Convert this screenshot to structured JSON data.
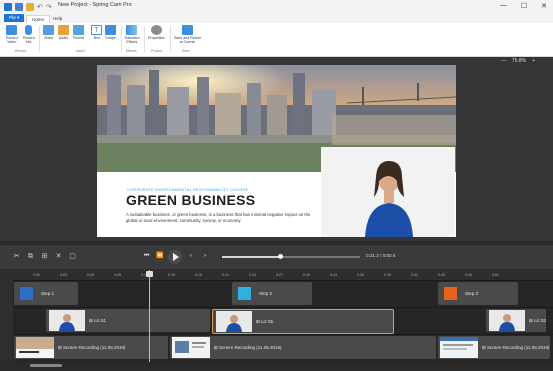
{
  "app": {
    "title": "New Project - Spring Cam Pro",
    "window_controls": [
      "—",
      "☐",
      "✕"
    ]
  },
  "ribbon": {
    "file_label": "File",
    "tabs": [
      {
        "label": "Home",
        "active": true
      },
      {
        "label": "Help",
        "active": false
      }
    ],
    "buttons": [
      {
        "label": "Record\nVideo",
        "icon": "record-video-icon"
      },
      {
        "label": "Record\nMic",
        "icon": "record-mic-icon"
      },
      {
        "label": "Video",
        "icon": "video-icon"
      },
      {
        "label": "Audio",
        "icon": "audio-icon"
      },
      {
        "label": "Picture",
        "icon": "picture-icon"
      },
      {
        "label": "Text",
        "icon": "text-icon"
      },
      {
        "label": "Shape",
        "icon": "shape-icon"
      },
      {
        "label": "Transition\nEffects",
        "icon": "transition-effects-icon"
      },
      {
        "label": "Properties",
        "icon": "properties-icon"
      },
      {
        "label": "Save and Return\nto Course",
        "icon": "save-return-icon"
      }
    ],
    "groups": [
      "Record",
      "Insert",
      "Effects",
      "Project",
      "Save"
    ]
  },
  "canvas": {
    "zoom_minus": "—",
    "zoom_value": "75.8%",
    "zoom_plus": "+",
    "slide": {
      "subtitle": "CORPORATE ENVIRONMENTAL RESPONSIBILITY COURSE",
      "headline": "GREEN BUSINESS",
      "body": "A sustainable business, or green business, is a business that has minimal negative impact on the global or local environment, community, society, or economy."
    }
  },
  "playback": {
    "tools": [
      "✂",
      "⧉",
      "⊞",
      "✕",
      "▢"
    ],
    "time": "0:21.2 / 0:50.6"
  },
  "timeline": {
    "ticks": [
      "0:00",
      "0:03",
      "0:06",
      "0:09",
      "0:12",
      "0:15",
      "0:18",
      "0:21",
      "0:24",
      "0:27",
      "0:30",
      "0:33",
      "0:36",
      "0:39",
      "0:42",
      "0:45",
      "0:48",
      "0:51"
    ],
    "steps": [
      {
        "label": "Step 1",
        "color": "#2f6fc9"
      },
      {
        "label": "Step 2",
        "color": "#2fb0e0"
      },
      {
        "label": "Step 3",
        "color": "#e8621c"
      }
    ],
    "video_clips": [
      {
        "label": "Liz 01"
      },
      {
        "label": "Liz 05"
      },
      {
        "label": "Liz 02"
      }
    ],
    "recordings": [
      {
        "label": "Screen Recording (11.08.2019)"
      },
      {
        "label": "Screen Recording (11.08.2019)"
      },
      {
        "label": "Screen Recording (11.08.2019)"
      }
    ]
  },
  "colors": {
    "accent": "#1e73d8",
    "selected_clip_border": "#e09a50",
    "subtitle_blue": "#4aa3d8"
  }
}
